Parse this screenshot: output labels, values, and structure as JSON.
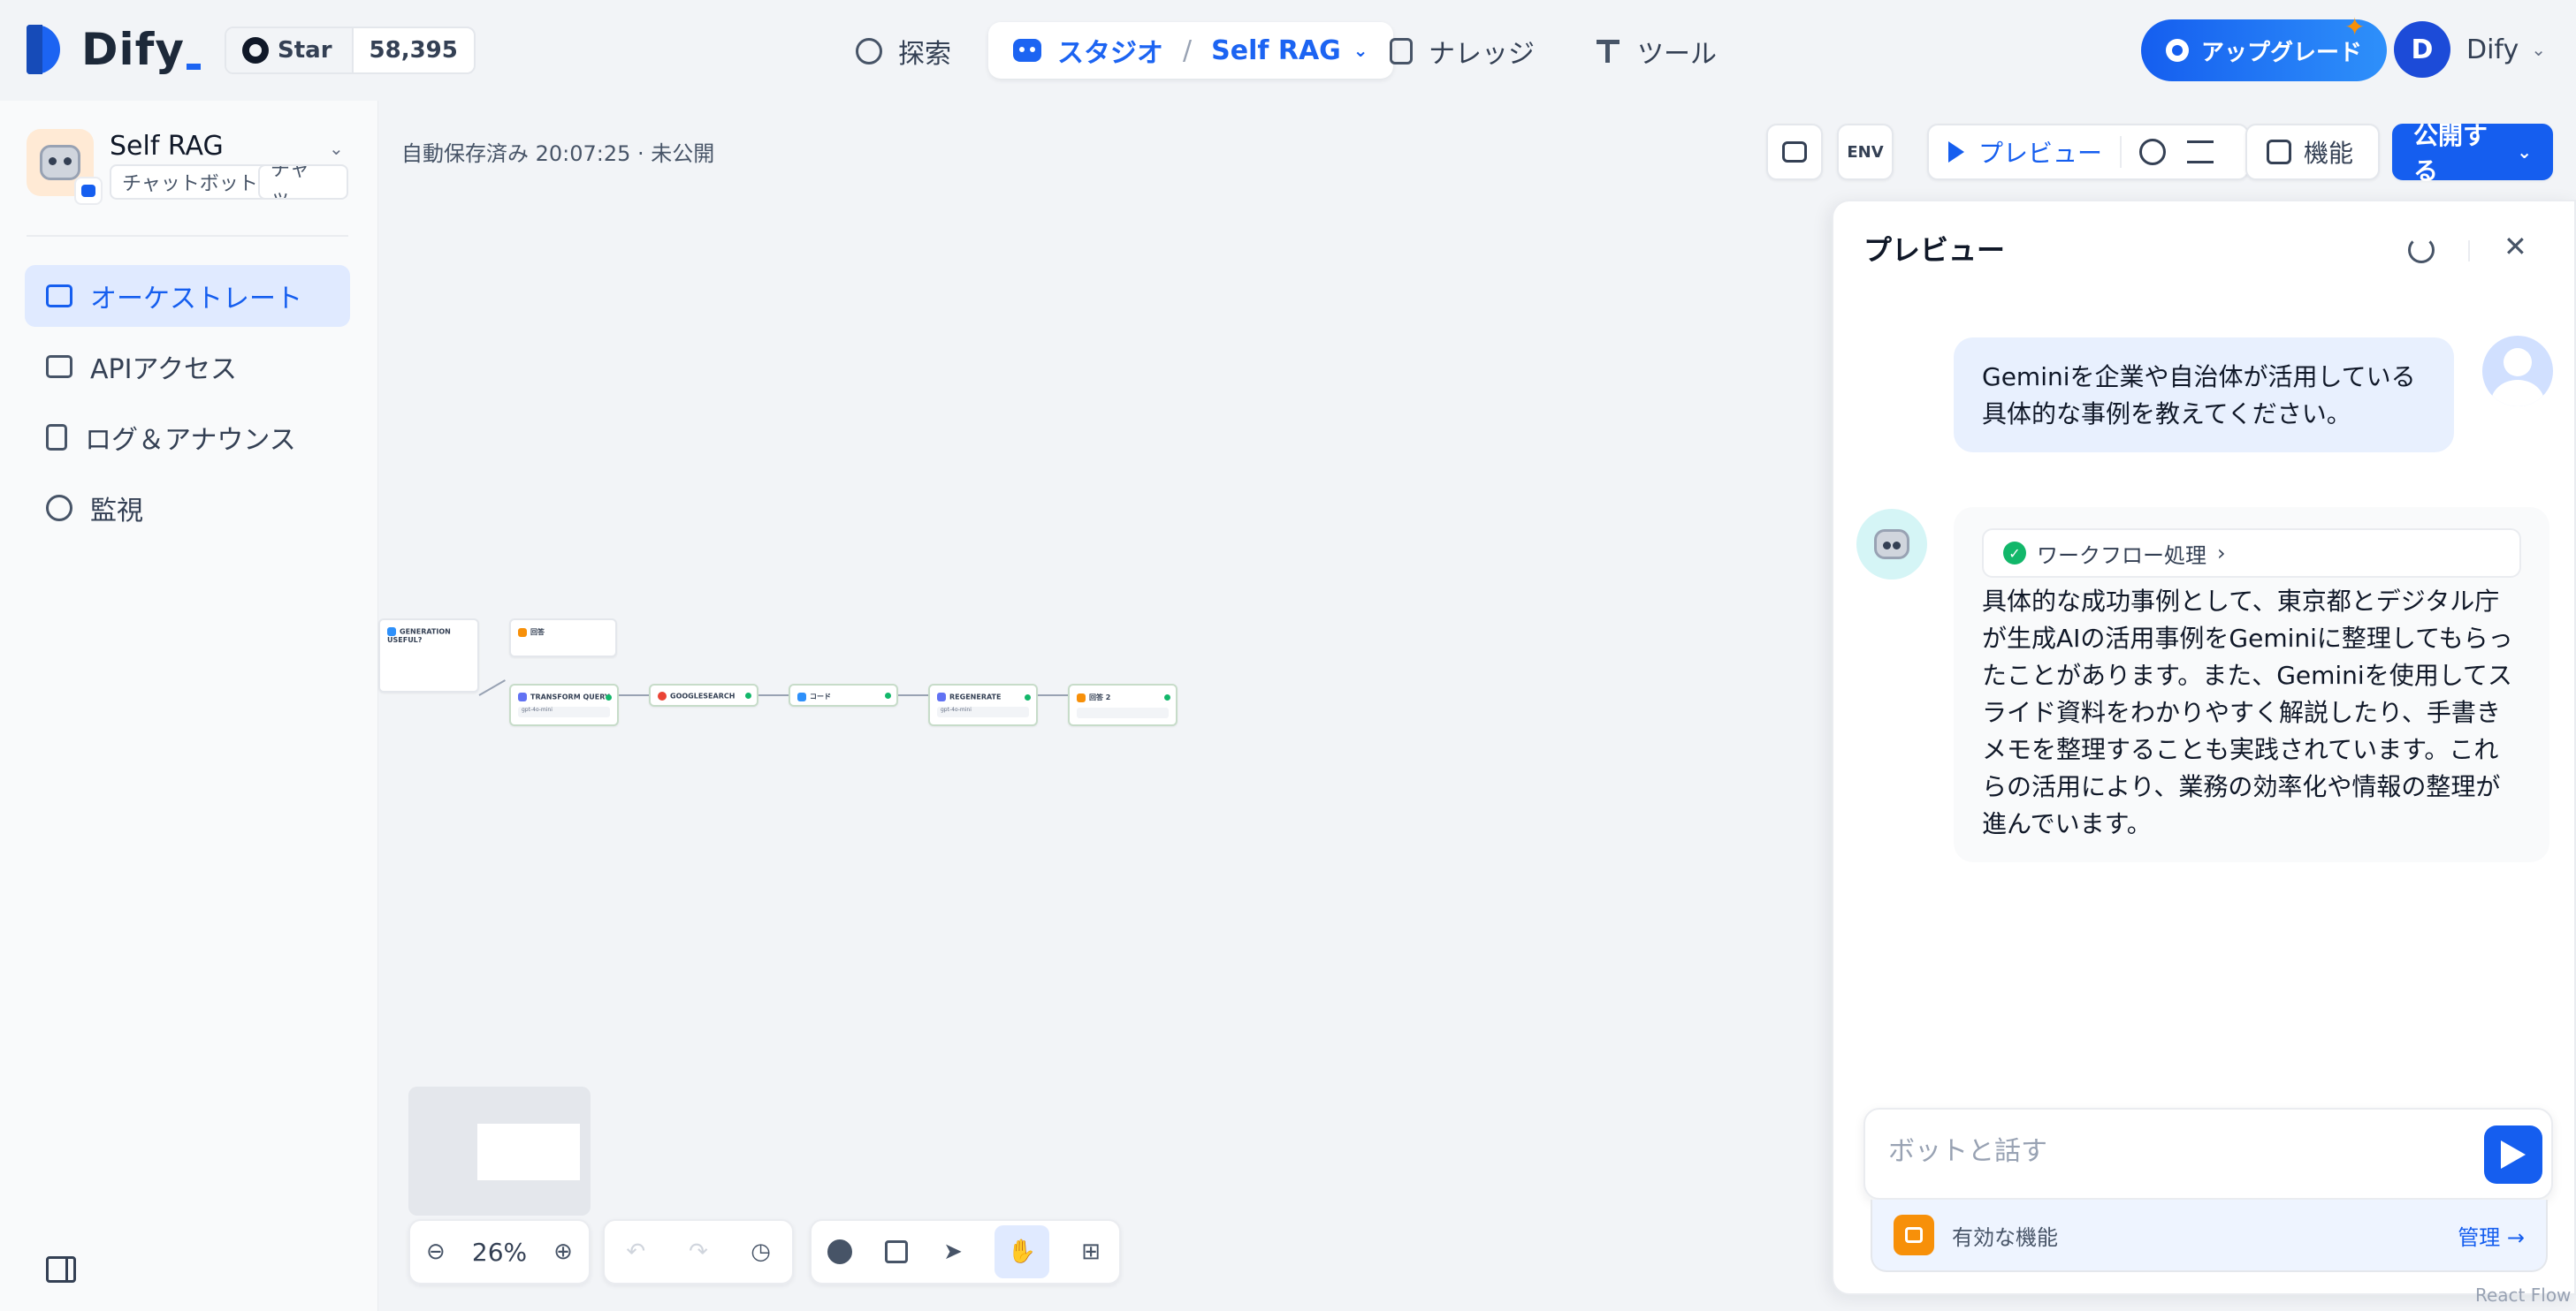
{
  "topbar": {
    "logo_text": "Dify",
    "github": {
      "star_label": "Star",
      "star_count": "58,395"
    },
    "nav": {
      "explore": "探索",
      "studio": "スタジオ",
      "app_name": "Self RAG",
      "knowledge": "ナレッジ",
      "tools": "ツール"
    },
    "upgrade_label": "アップグレード",
    "user": {
      "initial": "D",
      "name": "Dify"
    }
  },
  "sidebar": {
    "app": {
      "name": "Self RAG",
      "tags": [
        "チャットボット",
        "チャッ..."
      ]
    },
    "items": [
      {
        "label": "オーケストレート",
        "icon": "layout-icon",
        "active": true
      },
      {
        "label": "APIアクセス",
        "icon": "terminal-icon",
        "active": false
      },
      {
        "label": "ログ＆アナウンス",
        "icon": "file-list-icon",
        "active": false
      },
      {
        "label": "監視",
        "icon": "gauge-icon",
        "active": false
      }
    ]
  },
  "canvas": {
    "autosave": "自動保存済み 20:07:25 · 未公開",
    "env_label": "ENV",
    "zoom": "26%",
    "nodes": {
      "generation_useful": "GENERATION USEFUL?",
      "answer": "回答",
      "transform_query": "TRANSFORM QUERY",
      "googlesearch": "GOOGLESEARCH",
      "code": "コード",
      "regenerate": "REGENERATE",
      "answer2": "回答 2",
      "model": "gpt-4o-mini"
    }
  },
  "toolbar": {
    "preview_label": "プレビュー",
    "features_label": "機能",
    "publish_label": "公開する"
  },
  "preview": {
    "title": "プレビュー",
    "user_message": "Geminiを企業や自治体が活用している具体的な事例を教えてください。",
    "workflow_label": "ワークフロー処理",
    "bot_message": "具体的な成功事例として、東京都とデジタル庁が生成AIの活用事例をGeminiに整理してもらったことがあります。また、Geminiを使用してスライド資料をわかりやすく解説したり、手書きメモを整理することも実践されています。これらの活用により、業務の効率化や情報の整理が進んでいます。",
    "input_placeholder": "ボットと話す",
    "features_label": "有効な機能",
    "manage_label": "管理 →"
  },
  "footer": {
    "react_flow": "React Flow"
  },
  "colors": {
    "accent": "#155eef",
    "success": "#12b76a",
    "feature": "#f79009"
  }
}
